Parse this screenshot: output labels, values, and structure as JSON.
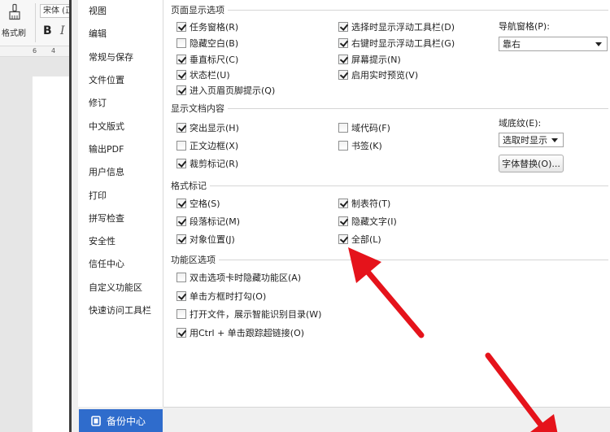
{
  "editor": {
    "format_painter_label": "格式刷",
    "font_name": "宋体 (正",
    "bold_label": "B",
    "italic_label": "I",
    "ruler_numbers": [
      "6",
      "4"
    ]
  },
  "sidebar": {
    "items": [
      "视图",
      "编辑",
      "常规与保存",
      "文件位置",
      "修订",
      "中文版式",
      "输出PDF",
      "用户信息",
      "打印",
      "拼写检查",
      "安全性",
      "信任中心",
      "自定义功能区",
      "快速访问工具栏"
    ],
    "backup_label": "备份中心"
  },
  "page_display": {
    "title": "页面显示选项",
    "left": [
      {
        "label": "任务窗格(R)",
        "checked": true
      },
      {
        "label": "隐藏空白(B)",
        "checked": false
      },
      {
        "label": "垂直标尺(C)",
        "checked": true
      },
      {
        "label": "状态栏(U)",
        "checked": true
      },
      {
        "label": "进入页眉页脚提示(Q)",
        "checked": true
      }
    ],
    "middle": [
      {
        "label": "选择时显示浮动工具栏(D)",
        "checked": true
      },
      {
        "label": "右键时显示浮动工具栏(G)",
        "checked": true
      },
      {
        "label": "屏幕提示(N)",
        "checked": true
      },
      {
        "label": "启用实时预览(V)",
        "checked": true
      }
    ],
    "nav_pane_label": "导航窗格(P):",
    "nav_pane_value": "靠右"
  },
  "document_content": {
    "title": "显示文档内容",
    "left": [
      {
        "label": "突出显示(H)",
        "checked": true
      },
      {
        "label": "正文边框(X)",
        "checked": false
      },
      {
        "label": "裁剪标记(R)",
        "checked": true
      }
    ],
    "middle": [
      {
        "label": "域代码(F)",
        "checked": false
      },
      {
        "label": "书签(K)",
        "checked": false
      }
    ],
    "field_shading_label": "域底纹(E):",
    "field_shading_value": "选取时显示",
    "font_substitution_button": "字体替换(O)..."
  },
  "formatting_marks": {
    "title": "格式标记",
    "left": [
      {
        "label": "空格(S)",
        "checked": true
      },
      {
        "label": "段落标记(M)",
        "checked": true
      },
      {
        "label": "对象位置(J)",
        "checked": true
      }
    ],
    "middle": [
      {
        "label": "制表符(T)",
        "checked": true
      },
      {
        "label": "隐藏文字(I)",
        "checked": true
      },
      {
        "label": "全部(L)",
        "checked": true
      }
    ]
  },
  "ribbon_options": {
    "title": "功能区选项",
    "options": [
      {
        "label": "双击选项卡时隐藏功能区(A)",
        "checked": false
      },
      {
        "label": "单击方框时打勾(O)",
        "checked": true
      },
      {
        "label": "打开文件，展示智能识别目录(W)",
        "checked": false
      },
      {
        "label": "用Ctrl + 单击跟踪超链接(O)",
        "checked": true
      }
    ]
  },
  "icons": {
    "format_painter": "brush-icon",
    "select_arrow": "chevron-down-icon",
    "backup": "backup-icon",
    "annotation": "red-arrow"
  },
  "colors": {
    "accent": "#2f6ccc",
    "annotation_red": "#e5131b",
    "panel_bg": "#ffffff",
    "dialog_bg": "#f0f0f0"
  }
}
